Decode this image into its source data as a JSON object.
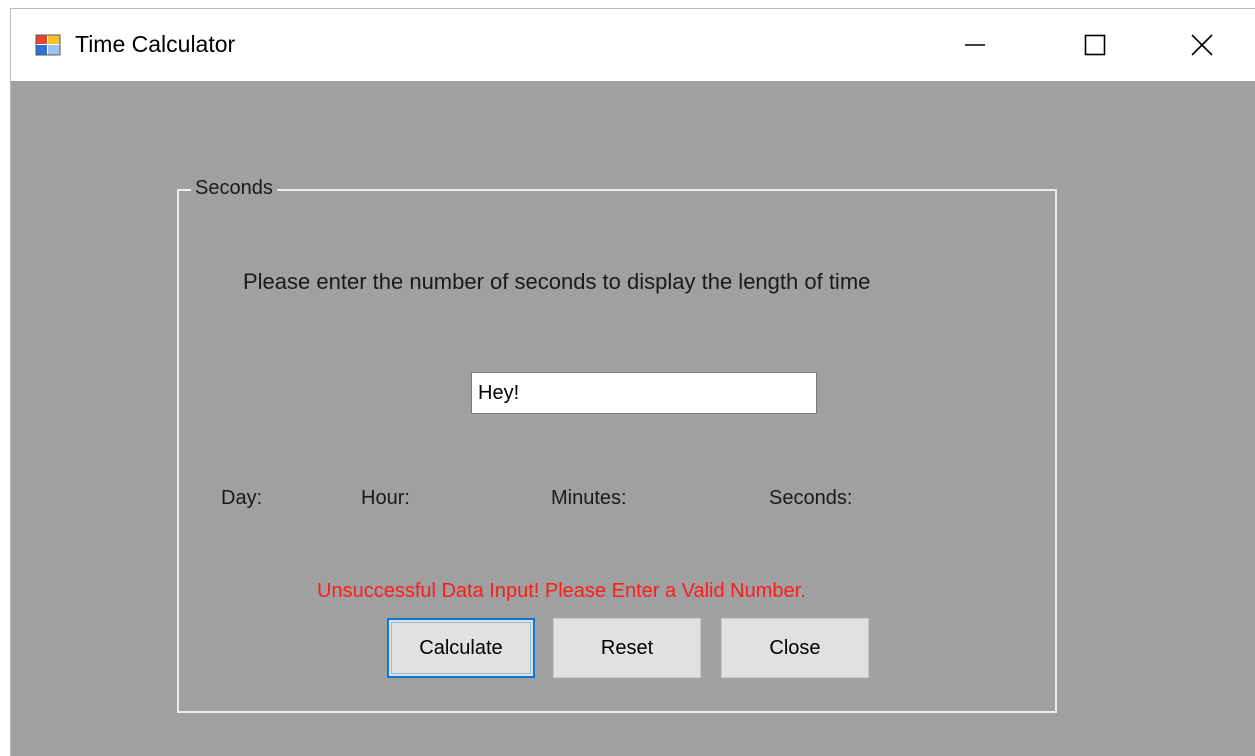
{
  "window": {
    "title": "Time Calculator",
    "controls": {
      "minimize": "minimize-icon",
      "maximize": "maximize-icon",
      "close": "close-icon"
    }
  },
  "form": {
    "group_label": "Seconds",
    "prompt": "Please enter the number of seconds to display the length of time",
    "seconds_input": {
      "value": "Hey!",
      "placeholder": ""
    },
    "labels": {
      "day": "Day:",
      "hour": "Hour:",
      "minutes": "Minutes:",
      "seconds": "Seconds:"
    },
    "error_message": "Unsuccessful Data Input! Please Enter a Valid Number.",
    "buttons": {
      "calculate": "Calculate",
      "reset": "Reset",
      "close": "Close"
    }
  },
  "colors": {
    "client_background": "#a0a0a0",
    "error_text": "#ff1b1b",
    "focus_border": "#0a78d7",
    "button_face": "#e1e1e1"
  }
}
